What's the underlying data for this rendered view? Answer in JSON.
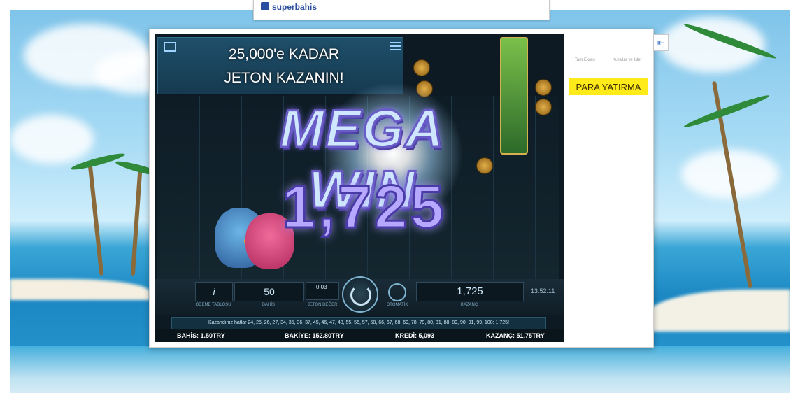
{
  "top_tab": {
    "brand": "superbahis"
  },
  "side_button_icon": "arrow-left-icon",
  "promo": {
    "line1": "25,000'e KADAR",
    "line2": "JETON KAZANIN!"
  },
  "win": {
    "title": "MEGA WIN",
    "amount": "1,725"
  },
  "controls": {
    "info_label": "i",
    "info_caption": "ÖDEME TABLOSU",
    "bet_value": "50",
    "bet_caption": "BAHİS",
    "coin_value": "0.03",
    "coin_caption": "JETON DEĞERİ",
    "auto_caption": "OTOMATİK",
    "win_value": "1,725",
    "win_caption": "KAZANÇ",
    "clock": "13:52:11"
  },
  "win_lines_text": "Kazandınız hatlar 24, 25, 26, 27, 34, 35, 36, 37, 45, 46, 47, 48, 55, 56, 57, 58, 66, 67, 68, 69, 78, 79, 80, 81, 88, 89, 90, 91, 99, 100: 1,725!",
  "status": {
    "bet_label": "BAHİS:",
    "bet_value": "1.50TRY",
    "balance_label": "BAKİYE:",
    "balance_value": "152.80TRY",
    "credit_label": "KREDİ:",
    "credit_value": "5,093",
    "win_label": "KAZANÇ:",
    "win_value": "51.75TRY"
  },
  "right_panel": {
    "link1": "Tam Ekran",
    "link2": "Kurallar ve İşler",
    "deposit_button": "PARA YATIRMA"
  },
  "colors": {
    "deposit_bg": "#ffeb1a",
    "game_bg": "#0d1a24",
    "mega_text": "#cfe6ff"
  }
}
